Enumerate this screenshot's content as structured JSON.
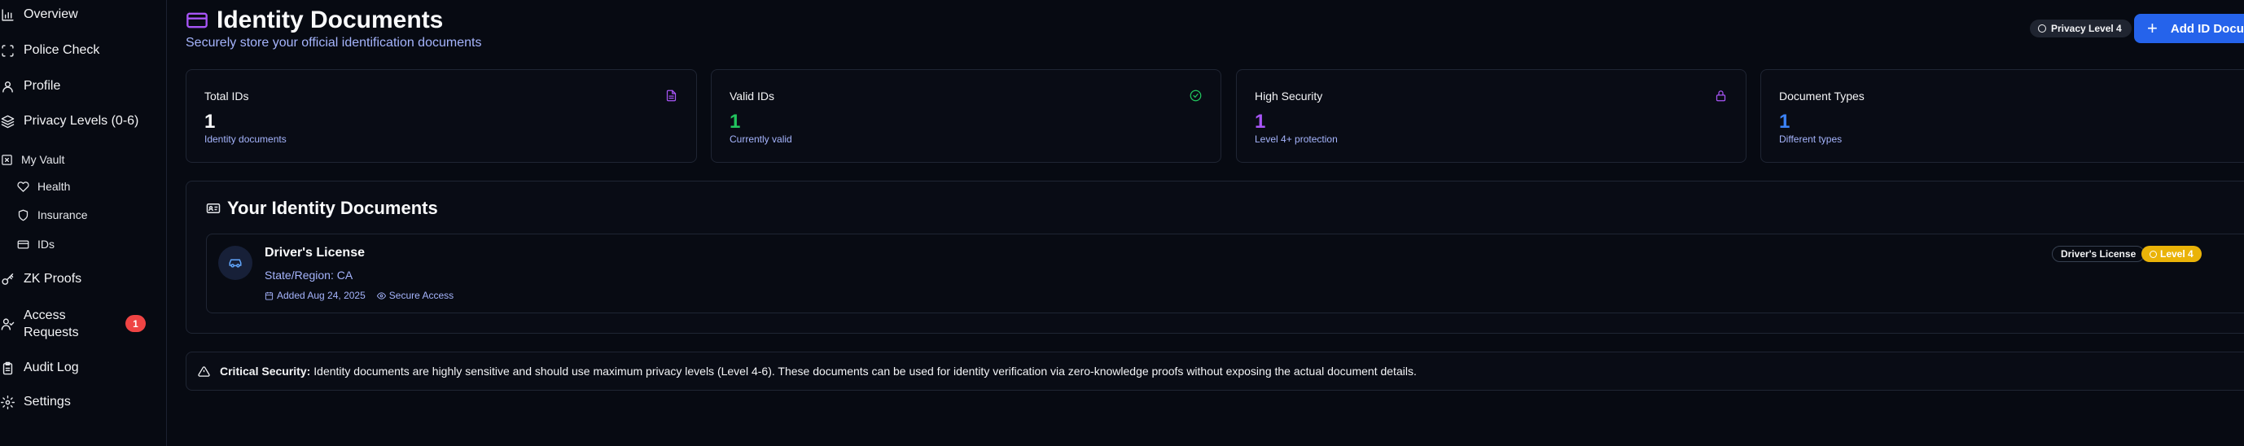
{
  "sidebar": {
    "items": [
      {
        "label": "Overview",
        "icon": "bar-chart-icon"
      },
      {
        "label": "Police Check",
        "icon": "scan-icon"
      },
      {
        "label": "Profile",
        "icon": "user-icon"
      },
      {
        "label": "Privacy Levels (0-6)",
        "icon": "layers-icon"
      },
      {
        "label": "My Vault",
        "icon": "vault-icon"
      },
      {
        "label": "Health",
        "icon": "heart-icon"
      },
      {
        "label": "Insurance",
        "icon": "shield-icon"
      },
      {
        "label": "IDs",
        "icon": "id-card-icon"
      },
      {
        "label": "ZK Proofs",
        "icon": "key-icon"
      },
      {
        "label": "Access",
        "label2": "Requests",
        "icon": "user-check-icon",
        "badge": "1"
      },
      {
        "label": "Audit Log",
        "icon": "clipboard-icon"
      },
      {
        "label": "Settings",
        "icon": "gear-icon"
      }
    ]
  },
  "header": {
    "title": "Identity Documents",
    "subtitle": "Securely store your official identification documents",
    "privacy_label": "Privacy Level 4",
    "add_button": "Add ID Document",
    "add_button_plus": "+"
  },
  "stats": [
    {
      "title": "Total IDs",
      "value": "1",
      "sub": "Identity documents",
      "color": "#f9fafb",
      "sub_color": "#a5b4fc",
      "icon": "file-icon",
      "icon_color": "#a855f7"
    },
    {
      "title": "Valid IDs",
      "value": "1",
      "sub": "Currently valid",
      "color": "#22c55e",
      "sub_color": "#a5b4fc",
      "icon": "check-circle-icon",
      "icon_color": "#22c55e"
    },
    {
      "title": "High Security",
      "value": "1",
      "sub": "Level 4+ protection",
      "color": "#a855f7",
      "sub_color": "#a5b4fc",
      "icon": "lock-icon",
      "icon_color": "#a855f7"
    },
    {
      "title": "Document Types",
      "value": "1",
      "sub": "Different types",
      "color": "#3b82f6",
      "sub_color": "#a5b4fc",
      "icon": "id-card-icon",
      "icon_color": "#3b82f6"
    }
  ],
  "documents_panel": {
    "title": "Your Identity Documents",
    "items": [
      {
        "name": "Driver's License",
        "region": "State/Region: CA",
        "added": "Added Aug 24, 2025",
        "access": "Secure Access",
        "type_badge": "Driver's License",
        "level_badge": "Level 4"
      }
    ]
  },
  "alert": {
    "label": "Critical Security:",
    "text": "Identity documents are highly sensitive and should use maximum privacy levels (Level 4-6). These documents can be used for identity verification via zero-knowledge proofs without exposing the actual document details."
  }
}
